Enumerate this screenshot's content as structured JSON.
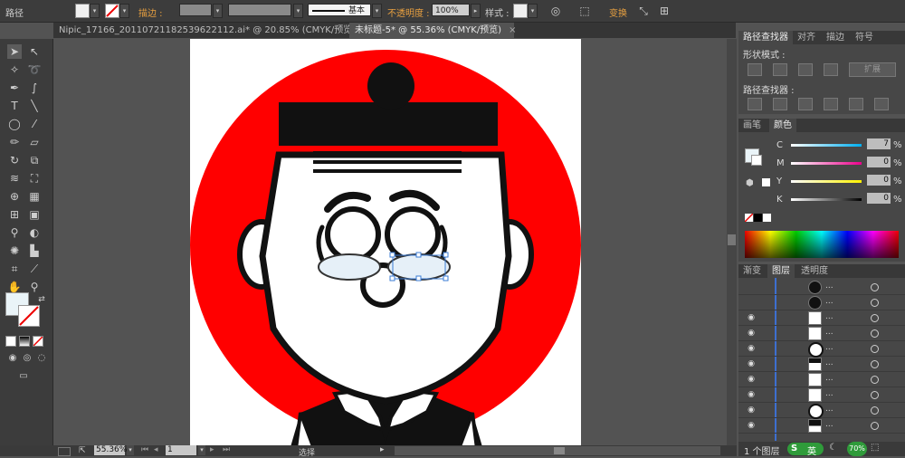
{
  "control_bar": {
    "object_type": "路径",
    "stroke_label": "描边 :",
    "brush_label": "基本",
    "opacity_label": "不透明度 :",
    "opacity_value": "100%",
    "style_label": "样式 :",
    "transform_label": "变换"
  },
  "doc_tabs": [
    {
      "label": "Nipic_17166_20110721182539622112.ai* @ 20.85% (CMYK/预览)",
      "active": false
    },
    {
      "label": "未标题-5* @ 55.36% (CMYK/预览)",
      "active": true
    }
  ],
  "tab_close": "×",
  "status_bar": {
    "zoom": "55.36%",
    "page": "1",
    "tool": "选择"
  },
  "pathfinder_panel": {
    "tabs": [
      "路径查找器",
      "对齐",
      "描边",
      "符号"
    ],
    "shape_modes_label": "形状模式 :",
    "expand_button": "扩展",
    "pathfinders_label": "路径查找器 :"
  },
  "color_panel": {
    "tabs": [
      "画笔",
      "颜色"
    ],
    "channels": [
      {
        "name": "C",
        "value": "7"
      },
      {
        "name": "M",
        "value": "0"
      },
      {
        "name": "Y",
        "value": "0"
      },
      {
        "name": "K",
        "value": "0"
      }
    ],
    "unit": "%"
  },
  "layers_panel": {
    "tabs": [
      "渐变",
      "图层",
      "透明度"
    ],
    "footer": "1 个图层",
    "row_dots": "..."
  },
  "taskbar": {
    "ime": "英",
    "battery": "70%"
  },
  "colors": {
    "accent_red": "#ff0000",
    "glasses_blue": "#e6f0f8",
    "ui_dark": "#3c3c3c"
  }
}
